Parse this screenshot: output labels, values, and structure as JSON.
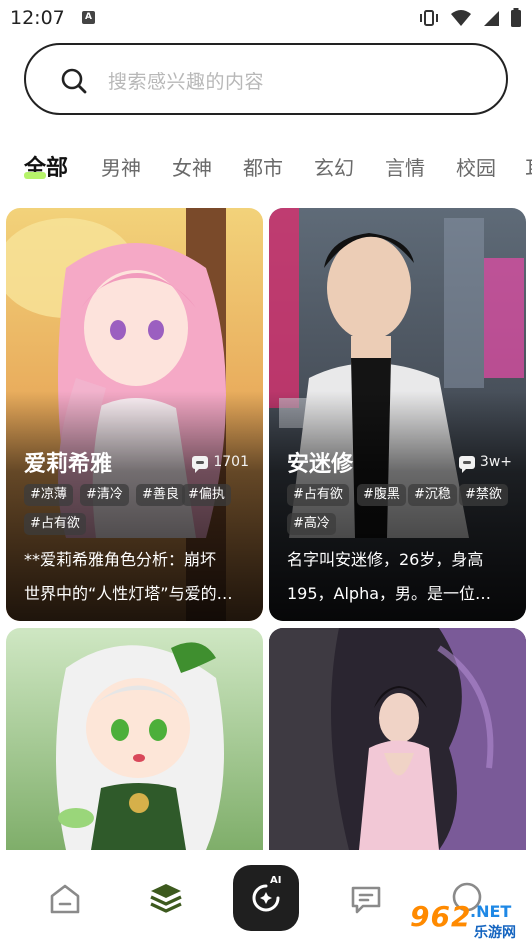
{
  "status": {
    "time": "12:07",
    "notif_icon_letter": "A"
  },
  "search": {
    "placeholder": "搜索感兴趣的内容"
  },
  "tabs": [
    {
      "label": "全部",
      "active": true
    },
    {
      "label": "男神"
    },
    {
      "label": "女神"
    },
    {
      "label": "都市"
    },
    {
      "label": "玄幻"
    },
    {
      "label": "言情"
    },
    {
      "label": "校园"
    },
    {
      "label": "耳"
    }
  ],
  "cards": [
    {
      "name": "爱莉希雅",
      "chat_count": "1701",
      "tags": [
        "#凉薄",
        "#清冷",
        "#善良",
        "#偏执",
        "#占有欲"
      ],
      "desc_line1": "**爱莉希雅角色分析：崩坏",
      "desc_line2": "世界中的“人性灯塔”与爱的…"
    },
    {
      "name": "安迷修",
      "chat_count": "3w+",
      "tags": [
        "#占有欲",
        "#腹黑",
        "#沉稳",
        "#禁欲",
        "#高冷"
      ],
      "desc_line1": "名字叫安迷修，26岁，身高",
      "desc_line2": "195，Alpha，男。是一位…"
    },
    {
      "name": "",
      "chat_count": "",
      "tags": []
    },
    {
      "name": "",
      "chat_count": "",
      "tags": []
    }
  ],
  "nav": {
    "items": [
      "home-icon",
      "layers-icon",
      "ai-create-icon",
      "message-icon",
      "profile-icon"
    ],
    "center_label": "AI",
    "active_color": "#3d5a1e"
  },
  "watermark": {
    "brand": "962",
    "suffix": ".NET",
    "cn": "乐游网"
  },
  "colors": {
    "accent": "#b6f36a",
    "text": "#1a1a1a",
    "muted": "#6a6a6a"
  }
}
